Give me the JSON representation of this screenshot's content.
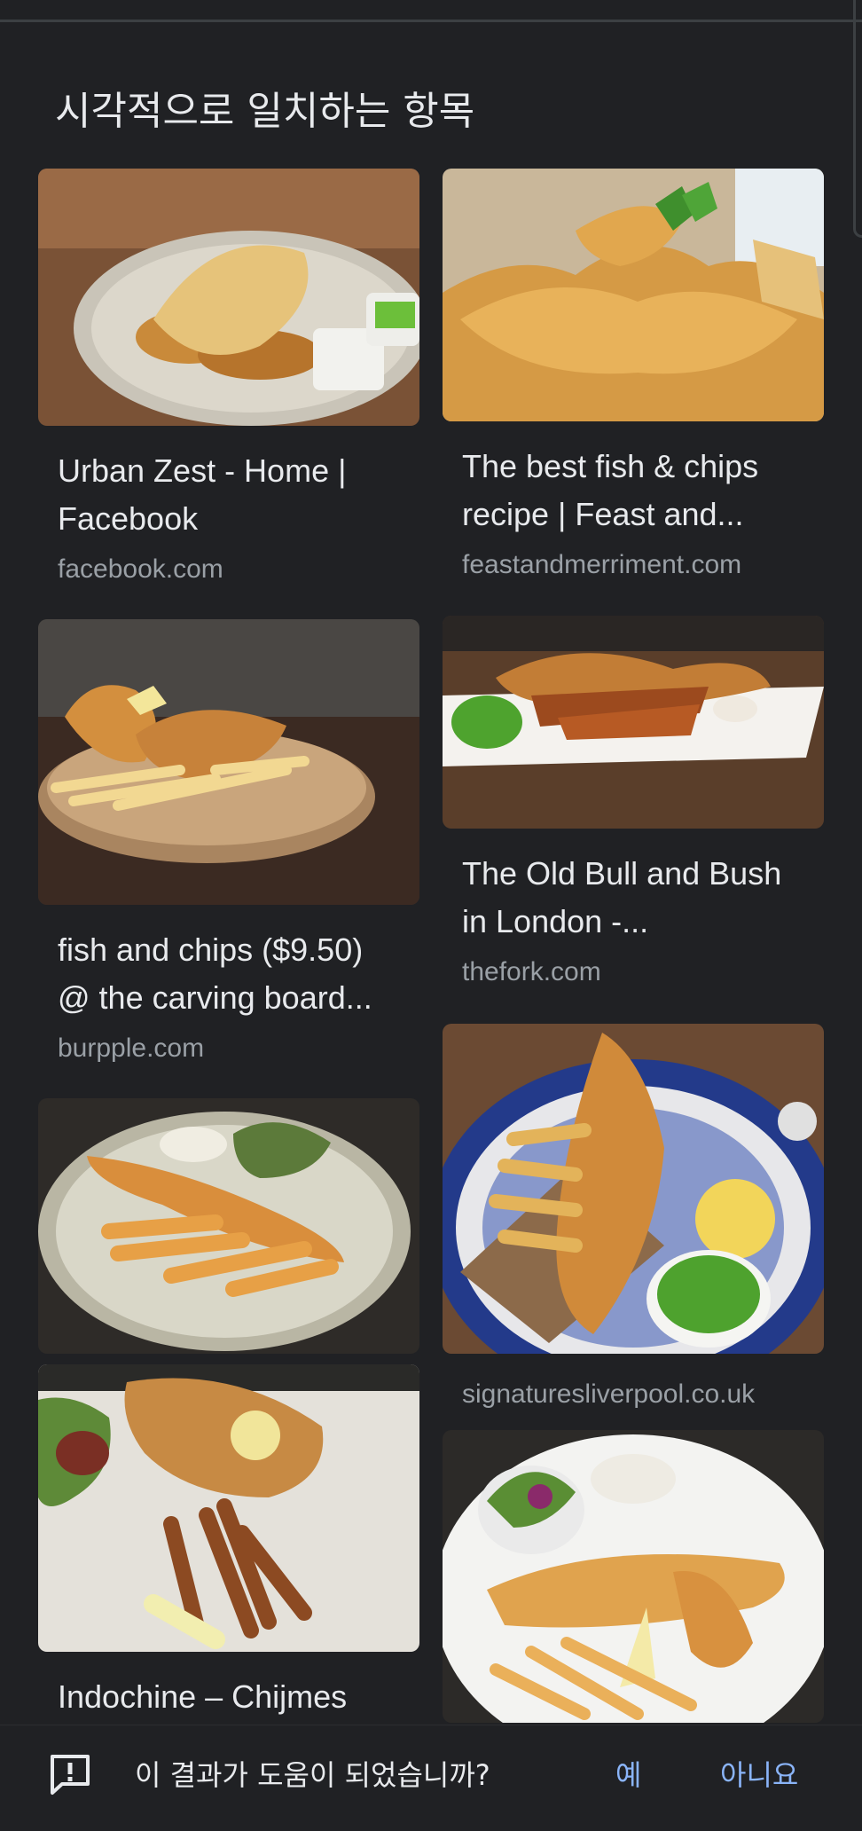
{
  "section": {
    "title": "시각적으로 일치하는 항목"
  },
  "results": [
    {
      "title": "Urban Zest - Home |\nFacebook",
      "source": "facebook.com"
    },
    {
      "title": "The best fish & chips\nrecipe | Feast and...",
      "source": "feastandmerriment.com"
    },
    {
      "title": "fish and chips ($9.50)\n@ the carving board...",
      "source": "burpple.com"
    },
    {
      "title": "The Old Bull and Bush\nin London -...",
      "source": "thefork.com"
    },
    {
      "title": "",
      "source": ""
    },
    {
      "title": "",
      "source": "signaturesliverpool.co.uk"
    },
    {
      "title": "Indochine – Chijmes",
      "source": ""
    },
    {
      "title": "",
      "source": ""
    }
  ],
  "feedback": {
    "question": "이 결과가 도움이 되었습니까?",
    "yes_label": "예",
    "no_label": "아니요",
    "icon": "feedback-icon"
  },
  "colors": {
    "background": "#202124",
    "text": "#e8eaed",
    "muted": "#9aa0a6",
    "accent": "#8ab4f8"
  }
}
